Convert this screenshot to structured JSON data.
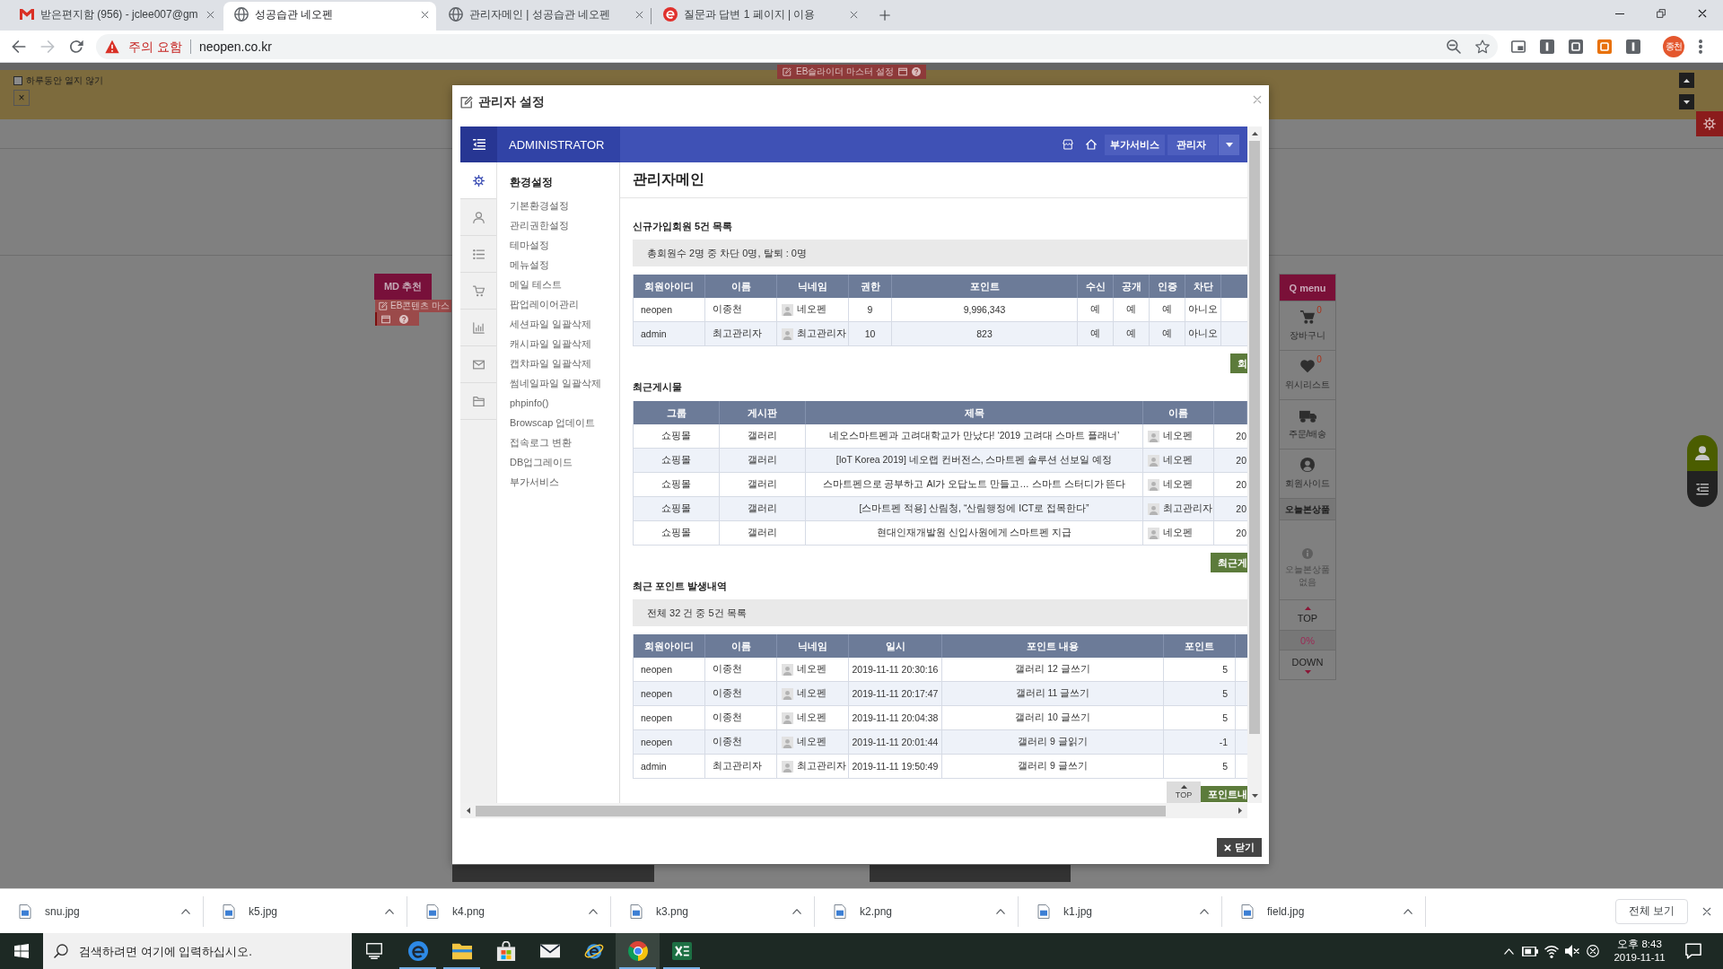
{
  "browser": {
    "tabs": [
      {
        "kind": "mail",
        "title": "받은편지함 (956) - jclee007@gm",
        "selected": false
      },
      {
        "kind": "globe",
        "title": "성공습관 네오펜",
        "selected": true
      },
      {
        "kind": "globe",
        "title": "관리자메인 | 성공습관 네오펜",
        "selected": false
      },
      {
        "kind": "e",
        "title": "질문과 답변 1 페이지 | 이용",
        "selected": false
      }
    ],
    "address": {
      "security": "주의 요함",
      "url": "neopen.co.kr"
    },
    "profile": "종천"
  },
  "page": {
    "notice": {
      "dismiss_label": "하루동안 열지 않기",
      "checked": false,
      "close_label": "×"
    },
    "slider_settings": "EB슬라이더 마스터 설정",
    "md_heading": "MD 추천",
    "content_settings": "EB콘텐츠 마스",
    "quick_menu": {
      "title": "Q menu",
      "items": [
        {
          "kind": "cart",
          "label": "장바구니",
          "count": "0"
        },
        {
          "kind": "wishlist",
          "label": "위시리스트",
          "count": "0"
        },
        {
          "kind": "delivery",
          "label": "주문/배송"
        },
        {
          "kind": "member",
          "label": "회원사이드"
        }
      ],
      "recent_title": "오늘본상품",
      "recent_empty": "오늘본상품 없음",
      "top": "TOP",
      "scroll_percent": "0%",
      "down": "DOWN"
    }
  },
  "modal": {
    "title": "관리자 설정",
    "close_button": "닫기",
    "admin": {
      "brand": "ADMINISTRATOR",
      "service_button": "부가서비스",
      "user_button": "관리자",
      "nav_icons": [
        {
          "kind": "settings",
          "selected": true
        },
        {
          "kind": "member",
          "selected": false
        },
        {
          "kind": "board",
          "selected": false
        },
        {
          "kind": "shop",
          "selected": false
        },
        {
          "kind": "stats",
          "selected": false
        },
        {
          "kind": "mail",
          "selected": false
        },
        {
          "kind": "folder",
          "selected": false
        }
      ],
      "menu_title": "환경설정",
      "menu_items": [
        "기본환경설정",
        "관리권한설정",
        "테마설정",
        "메뉴설정",
        "메일 테스트",
        "팝업레이어관리",
        "세션파일 일괄삭제",
        "캐시파일 일괄삭제",
        "캡챠파일 일괄삭제",
        "썸네일파일 일괄삭제",
        "phpinfo()",
        "Browscap 업데이트",
        "접속로그 변환",
        "DB업그레이드",
        "부가서비스"
      ],
      "page_title": "관리자메인",
      "sections": [
        {
          "title": "신규가입회원 5건 목록",
          "summary": "총회원수 2명 중 차단 0명, 탈퇴 : 0명",
          "columns": [
            {
              "label": "회원아이디",
              "kind": "text"
            },
            {
              "label": "이름",
              "kind": "text"
            },
            {
              "label": "닉네임",
              "kind": "nick"
            },
            {
              "label": "권한",
              "kind": "center"
            },
            {
              "label": "포인트",
              "kind": "center"
            },
            {
              "label": "수신",
              "kind": "center"
            },
            {
              "label": "공개",
              "kind": "center"
            },
            {
              "label": "인증",
              "kind": "center"
            },
            {
              "label": "차단",
              "kind": "center"
            }
          ],
          "rows": [
            [
              "neopen",
              "이종천",
              "네오펜",
              "9",
              "9,996,343",
              "예",
              "예",
              "예",
              "아니오"
            ],
            [
              "admin",
              "최고관리자",
              "최고관리자",
              "10",
              "823",
              "예",
              "예",
              "예",
              "아니오"
            ]
          ],
          "more_button": "회"
        },
        {
          "title": "최근게시물",
          "columns": [
            {
              "label": "그룹",
              "kind": "center"
            },
            {
              "label": "게시판",
              "kind": "center"
            },
            {
              "label": "제목",
              "kind": "center"
            },
            {
              "label": "이름",
              "kind": "nick"
            },
            {
              "kind": "cut"
            }
          ],
          "rows": [
            [
              "쇼핑몰",
              "갤러리",
              "네오스마트펜과 고려대학교가 만났다! ‘2019 고려대 스마트 플래너’",
              "네오펜",
              "20"
            ],
            [
              "쇼핑몰",
              "갤러리",
              "[IoT Korea 2019] 네오랩 컨버전스, 스마트펜 솔루션 선보일 예정",
              "네오펜",
              "20"
            ],
            [
              "쇼핑몰",
              "갤러리",
              "스마트펜으로 공부하고 AI가 오답노트 만들고… 스마트 스터디가 뜬다",
              "네오펜",
              "20"
            ],
            [
              "쇼핑몰",
              "갤러리",
              "[스마트펜 적용] 산림청, “산림행정에 ICT로 접목한다”",
              "최고관리자",
              "20"
            ],
            [
              "쇼핑몰",
              "갤러리",
              "현대인재개발원 신입사원에게 스마트펜 지급",
              "네오펜",
              "20"
            ]
          ],
          "more_button": "최근게"
        },
        {
          "title": "최근 포인트 발생내역",
          "summary": "전체 32 건 중 5건 목록",
          "columns": [
            {
              "label": "회원아이디",
              "kind": "text"
            },
            {
              "label": "이름",
              "kind": "text"
            },
            {
              "label": "닉네임",
              "kind": "nick"
            },
            {
              "label": "일시",
              "kind": "center"
            },
            {
              "label": "포인트 내용",
              "kind": "center"
            },
            {
              "label": "포인트",
              "kind": "number"
            }
          ],
          "rows": [
            [
              "neopen",
              "이종천",
              "네오펜",
              "2019-11-11 20:30:16",
              "갤러리 12 글쓰기",
              "5"
            ],
            [
              "neopen",
              "이종천",
              "네오펜",
              "2019-11-11 20:17:47",
              "갤러리 11 글쓰기",
              "5"
            ],
            [
              "neopen",
              "이종천",
              "네오펜",
              "2019-11-11 20:04:38",
              "갤러리 10 글쓰기",
              "5"
            ],
            [
              "neopen",
              "이종천",
              "네오펜",
              "2019-11-11 20:01:44",
              "갤러리 9 글읽기",
              "-1"
            ],
            [
              "admin",
              "최고관리자",
              "최고관리자",
              "2019-11-11 19:50:49",
              "갤러리 9 글쓰기",
              "5"
            ]
          ],
          "more_button": "포인트내"
        }
      ],
      "top_button": "TOP"
    }
  },
  "downloads": {
    "files": [
      "snu.jpg",
      "k5.jpg",
      "k4.png",
      "k3.png",
      "k2.png",
      "k1.jpg",
      "field.jpg"
    ],
    "show_all": "전체 보기"
  },
  "taskbar": {
    "search": {
      "placeholder": "검색하려면 여기에 입력하십시오."
    },
    "apps": [
      {
        "kind": "task-view",
        "selected": false,
        "running": false
      },
      {
        "kind": "edge",
        "selected": false,
        "running": true
      },
      {
        "kind": "explorer",
        "selected": false,
        "running": true
      },
      {
        "kind": "store",
        "selected": false,
        "running": false
      },
      {
        "kind": "mail",
        "selected": false,
        "running": false
      },
      {
        "kind": "ie",
        "selected": false,
        "running": false
      },
      {
        "kind": "chrome",
        "selected": true,
        "running": true
      },
      {
        "kind": "excel",
        "selected": false,
        "running": true
      }
    ],
    "time": "오후 8:43",
    "date": "2019-11-11"
  }
}
